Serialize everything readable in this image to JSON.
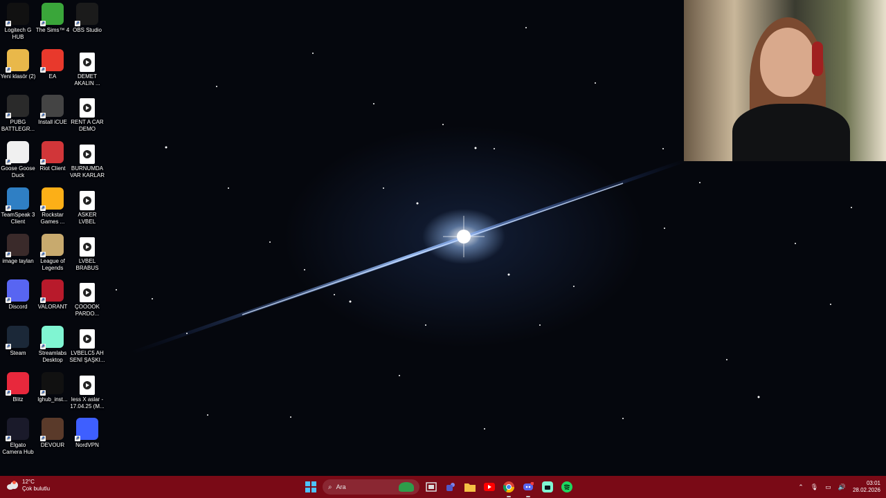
{
  "desktop": {
    "icons": [
      {
        "label": "Logitech G HUB",
        "icon": "logitech-g-icon",
        "color": "#111111"
      },
      {
        "label": "The Sims™ 4",
        "icon": "sims-plumbob-icon",
        "color": "#3aa63a"
      },
      {
        "label": "OBS Studio",
        "icon": "obs-icon",
        "color": "#1b1b1b"
      },
      {
        "label": "Yeni klasör (2)",
        "icon": "folder-icon",
        "color": "#e9b84a"
      },
      {
        "label": "EA",
        "icon": "ea-icon",
        "color": "#e8392c"
      },
      {
        "label": "DEMET AKALIN ...",
        "icon": "video-file-icon",
        "color": "#ffffff"
      },
      {
        "label": "PUBG BATTLEGR...",
        "icon": "pubg-icon",
        "color": "#2a2a2a"
      },
      {
        "label": "Install iCUE",
        "icon": "icue-installer-icon",
        "color": "#444444"
      },
      {
        "label": "RENT A CAR DEMO",
        "icon": "video-file-icon",
        "color": "#ffffff"
      },
      {
        "label": "Goose Goose Duck",
        "icon": "goose-icon",
        "color": "#f0f0f0"
      },
      {
        "label": "Riot Client",
        "icon": "riot-fist-icon",
        "color": "#d13639"
      },
      {
        "label": "BURNUMDA VAR KARLAR",
        "icon": "video-file-icon",
        "color": "#ffffff"
      },
      {
        "label": "TeamSpeak 3 Client",
        "icon": "teamspeak-icon",
        "color": "#2f7fc4"
      },
      {
        "label": "Rockstar Games ...",
        "icon": "rockstar-icon",
        "color": "#fcaf17"
      },
      {
        "label": "ASKER LVBEL",
        "icon": "video-file-icon",
        "color": "#ffffff"
      },
      {
        "label": "image taylan",
        "icon": "image-thumbnail-icon",
        "color": "#3a2a2a"
      },
      {
        "label": "League of Legends",
        "icon": "league-icon",
        "color": "#c8aa6e"
      },
      {
        "label": "LVBEL BRABUS",
        "icon": "video-file-icon",
        "color": "#ffffff"
      },
      {
        "label": "Discord",
        "icon": "discord-icon",
        "color": "#5865f2"
      },
      {
        "label": "VALORANT",
        "icon": "valorant-icon",
        "color": "#b81a2b"
      },
      {
        "label": "ÇOOOOK PARDO...",
        "icon": "video-file-icon",
        "color": "#ffffff"
      },
      {
        "label": "Steam",
        "icon": "steam-icon",
        "color": "#1b2838"
      },
      {
        "label": "Streamlabs Desktop",
        "icon": "streamlabs-icon",
        "color": "#80f5d2"
      },
      {
        "label": "LVBELC5 AH SENİ ŞAŞKI...",
        "icon": "video-file-icon",
        "color": "#ffffff"
      },
      {
        "label": "Blitz",
        "icon": "blitz-bolt-icon",
        "color": "#e8283c"
      },
      {
        "label": "lghub_inst...",
        "icon": "logitech-g-icon",
        "color": "#111111"
      },
      {
        "label": "less X aslar - 17.04.25 (M...",
        "icon": "video-file-icon",
        "color": "#ffffff"
      },
      {
        "label": "Elgato Camera Hub",
        "icon": "elgato-camera-icon",
        "color": "#1a1a2a"
      },
      {
        "label": "DEVOUR",
        "icon": "devour-icon",
        "color": "#5a3a2a"
      },
      {
        "label": "NordVPN",
        "icon": "nordvpn-icon",
        "color": "#3e5fff"
      }
    ]
  },
  "taskbar": {
    "weather": {
      "temp": "12°C",
      "condition": "Çok bulutlu"
    },
    "search_placeholder": "Ara",
    "apps": [
      {
        "name": "start-button",
        "icon": "windows-logo-icon",
        "color": "#4cc2ff"
      },
      {
        "name": "task-view-button",
        "icon": "task-view-icon",
        "color": "#dddddd"
      },
      {
        "name": "teams-button",
        "icon": "teams-icon",
        "color": "#7b83eb"
      },
      {
        "name": "file-explorer-button",
        "icon": "folder-icon",
        "color": "#f4c144"
      },
      {
        "name": "youtube-button",
        "icon": "youtube-icon",
        "color": "#ff0000"
      },
      {
        "name": "chrome-button",
        "icon": "chrome-icon",
        "color": "#4285f4"
      },
      {
        "name": "discord-button",
        "icon": "discord-icon",
        "color": "#5865f2"
      },
      {
        "name": "streamlabs-button",
        "icon": "streamlabs-icon",
        "color": "#80f5d2"
      },
      {
        "name": "spotify-button",
        "icon": "spotify-icon",
        "color": "#1ed760"
      }
    ],
    "clock": {
      "time": "03:01",
      "date": "28.02.2026"
    }
  }
}
